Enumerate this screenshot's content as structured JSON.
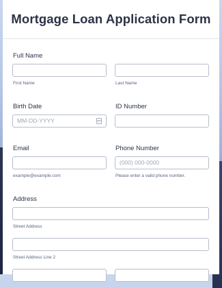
{
  "form": {
    "title": "Mortgage Loan Application Form",
    "full_name": {
      "label": "Full Name",
      "first_sub": "First Name",
      "last_sub": "Last Name",
      "first_value": "",
      "last_value": ""
    },
    "birth_date": {
      "label": "Birth Date",
      "placeholder": "MM-DD-YYYY"
    },
    "id_number": {
      "label": "ID Number",
      "value": ""
    },
    "email": {
      "label": "Email",
      "sub": "example@example.com",
      "value": ""
    },
    "phone": {
      "label": "Phone Number",
      "placeholder": "(000) 000-0000",
      "sub": "Please enter a valid phone number."
    },
    "address": {
      "label": "Address",
      "street_sub": "Street Address",
      "street2_sub": "Street Address Line 2"
    }
  }
}
